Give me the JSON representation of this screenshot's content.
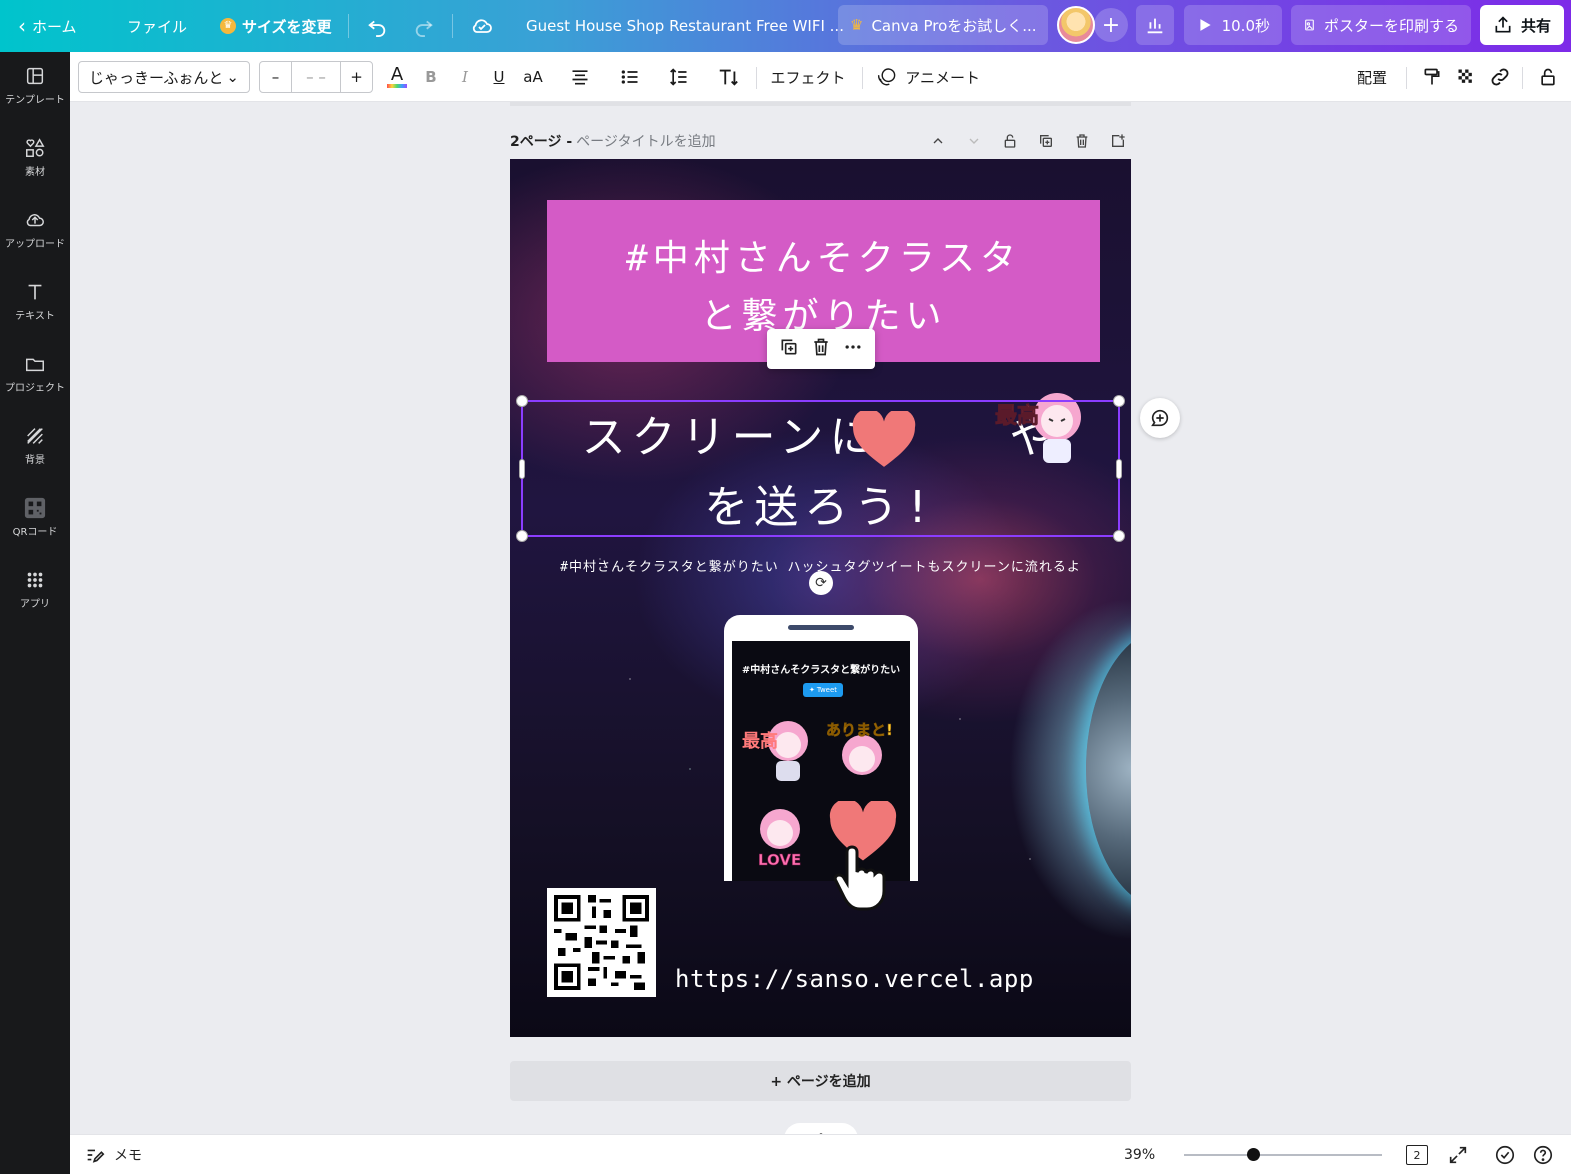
{
  "topbar": {
    "home": "ホーム",
    "file": "ファイル",
    "resize": "サイズを変更",
    "doc_title": "Guest House Shop Restaurant Free WIFI ...",
    "try_pro": "Canva Proをお試しく...",
    "play_duration": "10.0秒",
    "print_poster": "ポスターを印刷する",
    "share": "共有"
  },
  "sidebar": {
    "items": [
      {
        "label": "テンプレート",
        "icon": "template-icon"
      },
      {
        "label": "素材",
        "icon": "elements-icon"
      },
      {
        "label": "アップロード",
        "icon": "upload-icon"
      },
      {
        "label": "テキスト",
        "icon": "text-icon"
      },
      {
        "label": "プロジェクト",
        "icon": "folder-icon"
      },
      {
        "label": "背景",
        "icon": "background-icon"
      },
      {
        "label": "QRコード",
        "icon": "qr-code-icon"
      },
      {
        "label": "アプリ",
        "icon": "apps-icon"
      }
    ]
  },
  "toolbar": {
    "font_name": "じゃっきーふぉんと",
    "size_minus": "–",
    "size_value": "– –",
    "size_plus": "+",
    "text_color_letter": "A",
    "bold": "B",
    "italic": "I",
    "underline": "U",
    "case": "aA",
    "effects": "エフェクト",
    "animate": "アニメート",
    "arrange": "配置"
  },
  "page": {
    "number_label": "2ページ -",
    "title_placeholder": "ページタイトルを追加"
  },
  "poster": {
    "title_line1": "#中村さんそクラスタ",
    "title_line2": "と繋がりたい",
    "headline_line1": "スクリーンに    や",
    "headline_line2": "を送ろう!",
    "sticker_text": "最高",
    "subline": "#中村さんそクラスタと繋がりたい ハッシュタグツイートもスクリーンに流れるよ",
    "phone_title": "#中村さんそクラスタと繋がりたい",
    "phone_tweet": "Tweet",
    "phone_stickers": [
      "最高",
      "ありまと!",
      "LOVE"
    ],
    "url": "https://sanso.vercel.app"
  },
  "add_page": "+ ページを追加",
  "bottombar": {
    "notes": "メモ",
    "zoom": "39%",
    "page_count": "2"
  },
  "colors": {
    "title_box": "#d45bc6",
    "selection": "#8b3dff",
    "heart": "#f07878"
  }
}
